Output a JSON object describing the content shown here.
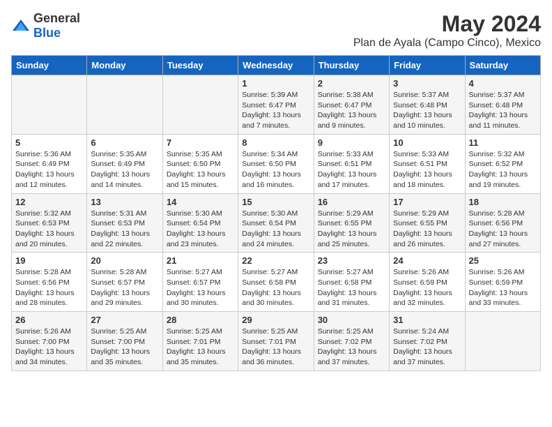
{
  "header": {
    "logo_general": "General",
    "logo_blue": "Blue",
    "title": "May 2024",
    "subtitle": "Plan de Ayala (Campo Cinco), Mexico"
  },
  "days_of_week": [
    "Sunday",
    "Monday",
    "Tuesday",
    "Wednesday",
    "Thursday",
    "Friday",
    "Saturday"
  ],
  "weeks": [
    [
      {
        "day": "",
        "info": ""
      },
      {
        "day": "",
        "info": ""
      },
      {
        "day": "",
        "info": ""
      },
      {
        "day": "1",
        "info": "Sunrise: 5:39 AM\nSunset: 6:47 PM\nDaylight: 13 hours\nand 7 minutes."
      },
      {
        "day": "2",
        "info": "Sunrise: 5:38 AM\nSunset: 6:47 PM\nDaylight: 13 hours\nand 9 minutes."
      },
      {
        "day": "3",
        "info": "Sunrise: 5:37 AM\nSunset: 6:48 PM\nDaylight: 13 hours\nand 10 minutes."
      },
      {
        "day": "4",
        "info": "Sunrise: 5:37 AM\nSunset: 6:48 PM\nDaylight: 13 hours\nand 11 minutes."
      }
    ],
    [
      {
        "day": "5",
        "info": "Sunrise: 5:36 AM\nSunset: 6:49 PM\nDaylight: 13 hours\nand 12 minutes."
      },
      {
        "day": "6",
        "info": "Sunrise: 5:35 AM\nSunset: 6:49 PM\nDaylight: 13 hours\nand 14 minutes."
      },
      {
        "day": "7",
        "info": "Sunrise: 5:35 AM\nSunset: 6:50 PM\nDaylight: 13 hours\nand 15 minutes."
      },
      {
        "day": "8",
        "info": "Sunrise: 5:34 AM\nSunset: 6:50 PM\nDaylight: 13 hours\nand 16 minutes."
      },
      {
        "day": "9",
        "info": "Sunrise: 5:33 AM\nSunset: 6:51 PM\nDaylight: 13 hours\nand 17 minutes."
      },
      {
        "day": "10",
        "info": "Sunrise: 5:33 AM\nSunset: 6:51 PM\nDaylight: 13 hours\nand 18 minutes."
      },
      {
        "day": "11",
        "info": "Sunrise: 5:32 AM\nSunset: 6:52 PM\nDaylight: 13 hours\nand 19 minutes."
      }
    ],
    [
      {
        "day": "12",
        "info": "Sunrise: 5:32 AM\nSunset: 6:53 PM\nDaylight: 13 hours\nand 20 minutes."
      },
      {
        "day": "13",
        "info": "Sunrise: 5:31 AM\nSunset: 6:53 PM\nDaylight: 13 hours\nand 22 minutes."
      },
      {
        "day": "14",
        "info": "Sunrise: 5:30 AM\nSunset: 6:54 PM\nDaylight: 13 hours\nand 23 minutes."
      },
      {
        "day": "15",
        "info": "Sunrise: 5:30 AM\nSunset: 6:54 PM\nDaylight: 13 hours\nand 24 minutes."
      },
      {
        "day": "16",
        "info": "Sunrise: 5:29 AM\nSunset: 6:55 PM\nDaylight: 13 hours\nand 25 minutes."
      },
      {
        "day": "17",
        "info": "Sunrise: 5:29 AM\nSunset: 6:55 PM\nDaylight: 13 hours\nand 26 minutes."
      },
      {
        "day": "18",
        "info": "Sunrise: 5:28 AM\nSunset: 6:56 PM\nDaylight: 13 hours\nand 27 minutes."
      }
    ],
    [
      {
        "day": "19",
        "info": "Sunrise: 5:28 AM\nSunset: 6:56 PM\nDaylight: 13 hours\nand 28 minutes."
      },
      {
        "day": "20",
        "info": "Sunrise: 5:28 AM\nSunset: 6:57 PM\nDaylight: 13 hours\nand 29 minutes."
      },
      {
        "day": "21",
        "info": "Sunrise: 5:27 AM\nSunset: 6:57 PM\nDaylight: 13 hours\nand 30 minutes."
      },
      {
        "day": "22",
        "info": "Sunrise: 5:27 AM\nSunset: 6:58 PM\nDaylight: 13 hours\nand 30 minutes."
      },
      {
        "day": "23",
        "info": "Sunrise: 5:27 AM\nSunset: 6:58 PM\nDaylight: 13 hours\nand 31 minutes."
      },
      {
        "day": "24",
        "info": "Sunrise: 5:26 AM\nSunset: 6:59 PM\nDaylight: 13 hours\nand 32 minutes."
      },
      {
        "day": "25",
        "info": "Sunrise: 5:26 AM\nSunset: 6:59 PM\nDaylight: 13 hours\nand 33 minutes."
      }
    ],
    [
      {
        "day": "26",
        "info": "Sunrise: 5:26 AM\nSunset: 7:00 PM\nDaylight: 13 hours\nand 34 minutes."
      },
      {
        "day": "27",
        "info": "Sunrise: 5:25 AM\nSunset: 7:00 PM\nDaylight: 13 hours\nand 35 minutes."
      },
      {
        "day": "28",
        "info": "Sunrise: 5:25 AM\nSunset: 7:01 PM\nDaylight: 13 hours\nand 35 minutes."
      },
      {
        "day": "29",
        "info": "Sunrise: 5:25 AM\nSunset: 7:01 PM\nDaylight: 13 hours\nand 36 minutes."
      },
      {
        "day": "30",
        "info": "Sunrise: 5:25 AM\nSunset: 7:02 PM\nDaylight: 13 hours\nand 37 minutes."
      },
      {
        "day": "31",
        "info": "Sunrise: 5:24 AM\nSunset: 7:02 PM\nDaylight: 13 hours\nand 37 minutes."
      },
      {
        "day": "",
        "info": ""
      }
    ]
  ]
}
